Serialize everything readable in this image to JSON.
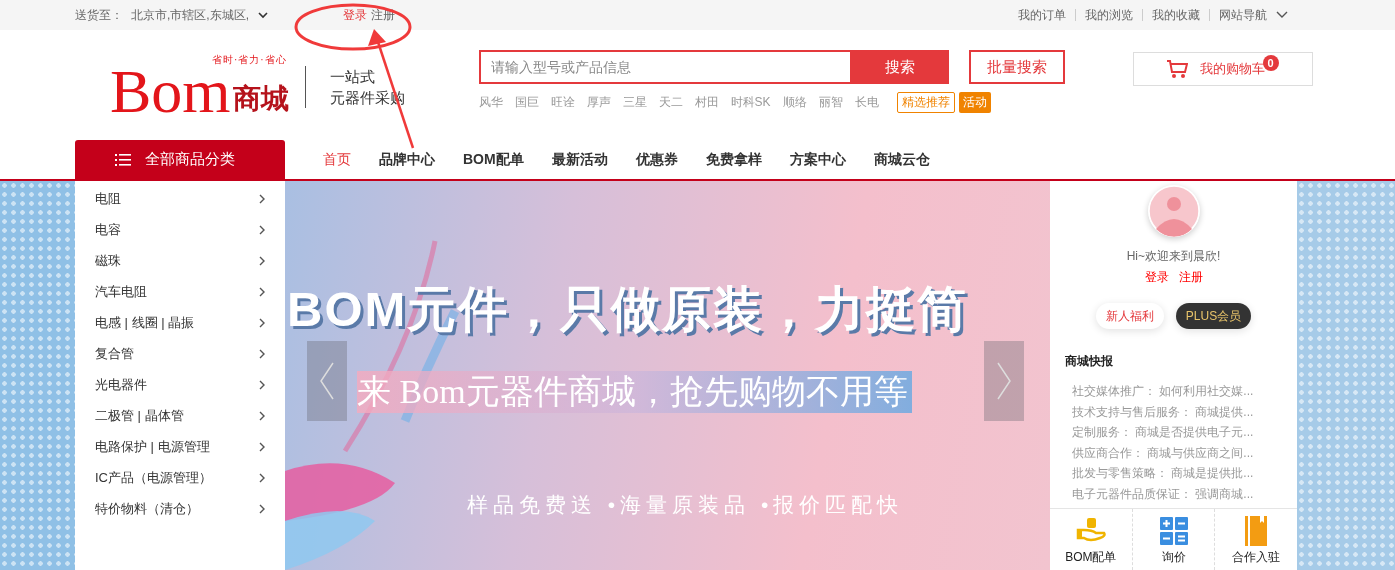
{
  "top_bar": {
    "ship_to_label": "送货至：",
    "location": "北京市,市辖区,东城区,",
    "login": "登录",
    "register": "注册",
    "links": [
      "我的订单",
      "我的浏览",
      "我的收藏",
      "网站导航"
    ]
  },
  "header": {
    "logo": {
      "slogan": "省时·省力·省心",
      "brand_latin": "Bom",
      "brand_cn": "商城"
    },
    "tagline": [
      "一站式",
      "元器件采购"
    ],
    "search": {
      "placeholder": "请输入型号或产品信息",
      "button": "搜索"
    },
    "batch_search": "批量搜索",
    "hot_brands": [
      "风华",
      "国巨",
      "旺诠",
      "厚声",
      "三星",
      "天二",
      "村田",
      "时科SK",
      "顺络",
      "丽智",
      "长电"
    ],
    "featured_tag": "精选推荐",
    "activity_tag": "活动",
    "cart": {
      "label": "我的购物车",
      "count": "0"
    }
  },
  "nav": {
    "all_categories": "全部商品分类",
    "items": [
      {
        "label": "首页",
        "selected": true
      },
      {
        "label": "品牌中心",
        "selected": false
      },
      {
        "label": "BOM配单",
        "selected": false
      },
      {
        "label": "最新活动",
        "selected": false
      },
      {
        "label": "优惠券",
        "selected": false
      },
      {
        "label": "免费拿样",
        "selected": false
      },
      {
        "label": "方案中心",
        "selected": false
      },
      {
        "label": "商城云仓",
        "selected": false
      }
    ]
  },
  "categories": [
    "电阻",
    "电容",
    "磁珠",
    "汽车电阻",
    "电感 | 线圈 | 晶振",
    "复合管",
    "光电器件",
    "二极管 | 晶体管",
    "电路保护 | 电源管理",
    "IC产品（电源管理）",
    "特价物料（清仓）"
  ],
  "banner": {
    "headline": "BOM元件，只做原装，力挺简",
    "subheadline": "来 Bom元器件商城，抢先购物不用等",
    "features": "样品免费送 •海量原装品 •报价匹配快"
  },
  "user_panel": {
    "greeting": "Hi~欢迎来到晨欣!",
    "login": "登录",
    "register": "注册",
    "buttons": [
      "新人福利",
      "PLUS会员"
    ],
    "news_title": "商城快报",
    "news": [
      "社交媒体推广： 如何利用社交媒...",
      "技术支持与售后服务： 商城提供...",
      "定制服务： 商城是否提供电子元...",
      "供应商合作： 商城与供应商之间...",
      "批发与零售策略： 商城是提供批...",
      "电子元器件品质保证： 强调商城..."
    ],
    "quick_links": [
      {
        "kind": "bom",
        "label": "BOM配单"
      },
      {
        "kind": "calc",
        "label": "询价"
      },
      {
        "kind": "book",
        "label": "合作入驻"
      }
    ]
  }
}
